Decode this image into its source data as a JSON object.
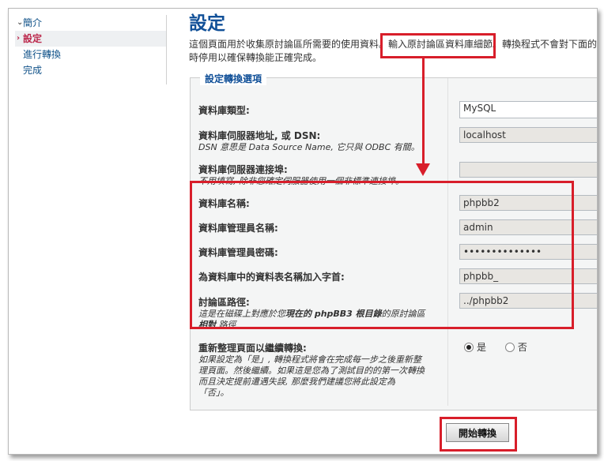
{
  "nav": {
    "items": [
      {
        "label": "簡介",
        "active": false
      },
      {
        "label": "設定",
        "active": true
      },
      {
        "label": "進行轉換",
        "active": false
      },
      {
        "label": "完成",
        "active": false
      }
    ]
  },
  "page": {
    "title": "設定",
    "intro_line1": "這個頁面用於收集原討論區所需要的使用資料。輸入原討論區資料庫細節。轉換程式不會對下面的資",
    "intro_line2": "時停用以確保轉換能正確完成。"
  },
  "fieldset": {
    "legend": "設定轉換選項",
    "fields": {
      "db_type": {
        "label": "資料庫類型:",
        "value": "MySQL"
      },
      "db_host": {
        "label": "資料庫伺服器地址, 或 DSN:",
        "explain": "DSN 意思是 Data Source Name, 它只與 ODBC 有關。",
        "value": "localhost"
      },
      "db_port": {
        "label": "資料庫伺服器連接埠:",
        "explain": "不用填寫, 除非您確定伺服器使用一個非標準連接埠。",
        "value": ""
      },
      "db_name": {
        "label": "資料庫名稱:",
        "value": "phpbb2"
      },
      "db_user": {
        "label": "資料庫管理員名稱:",
        "value": "admin"
      },
      "db_pass": {
        "label": "資料庫管理員密碼:",
        "value": "••••••••••••••"
      },
      "table_prefix": {
        "label": "為資料庫中的資料表名稱加入字首:",
        "value": "phpbb_"
      },
      "forum_path": {
        "label": "討論區路徑:",
        "explain_1": "這是在磁碟上對應於您",
        "explain_bold": "現在的 phpBB3 根目錄",
        "explain_2": "的原討論區",
        "explain_3": "相對",
        "explain_4": "路徑",
        "value": "../phpbb2"
      },
      "refresh": {
        "label": "重新整理頁面以繼續轉換:",
        "explain_l1": "如果設定為「是」, 轉換程式將會在完成每一步之後重新整",
        "explain_l2": "理頁面。然後繼續。如果這是您為了測試目的的第一次轉換",
        "explain_l3": "而且決定提前遭遇失誤, 那麼我們建議您將此設定為",
        "explain_l4": "「否」。",
        "yes": "是",
        "no": "否"
      }
    }
  },
  "submit": {
    "label": "開始轉換"
  },
  "colors": {
    "accent": "#115098",
    "highlight": "#d81e2a",
    "active_nav": "#bc2a4d"
  }
}
